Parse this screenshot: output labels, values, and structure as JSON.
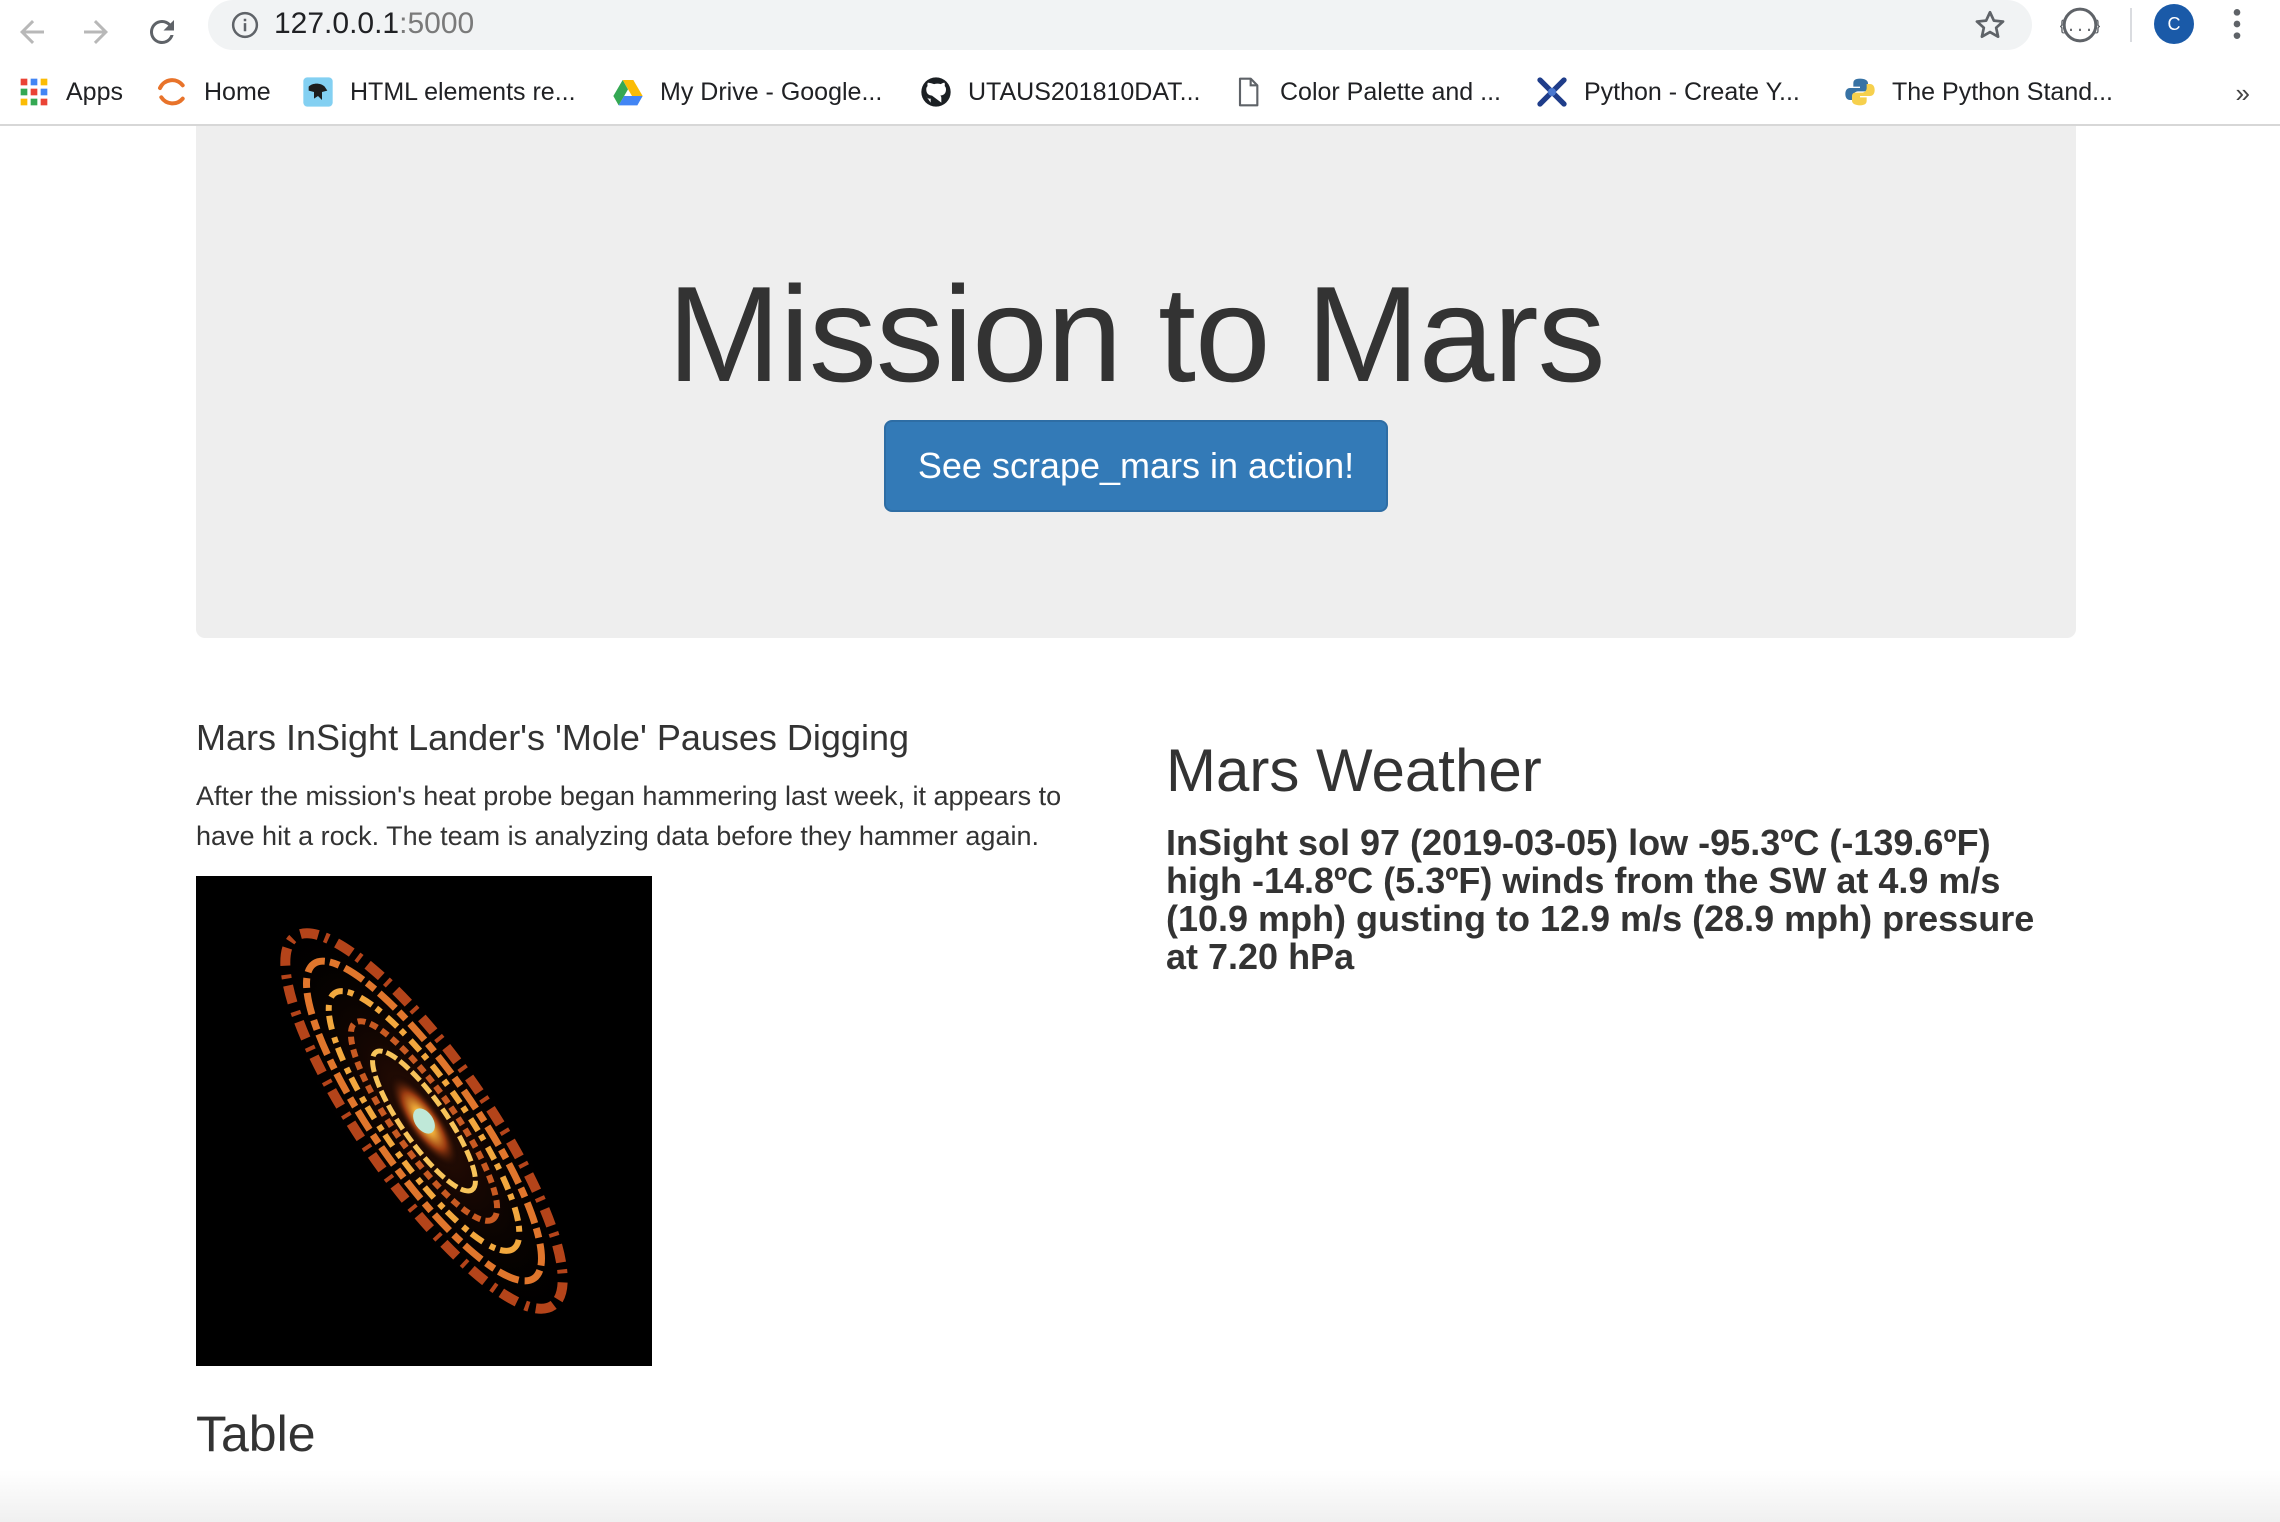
{
  "browser": {
    "url_host": "127.0.0.1",
    "url_port": ":5000",
    "profile_initial": "C",
    "bookmarks": [
      {
        "label": "Apps",
        "icon": "apps-grid-icon"
      },
      {
        "label": "Home",
        "icon": "home-swirl-icon"
      },
      {
        "label": "HTML elements re...",
        "icon": "mdn-dino-icon"
      },
      {
        "label": "My Drive - Google...",
        "icon": "google-drive-icon"
      },
      {
        "label": "UTAUS201810DAT...",
        "icon": "github-icon"
      },
      {
        "label": "Color Palette and ...",
        "icon": "document-icon"
      },
      {
        "label": "Python - Create Y...",
        "icon": "python-x-icon"
      },
      {
        "label": "The Python Stand...",
        "icon": "python-logo-icon"
      }
    ],
    "bookmarks_more": "»"
  },
  "page": {
    "title": "Mission to Mars",
    "action_button": "See scrape_mars in action!",
    "news_title": "Mars InSight Lander's 'Mole' Pauses Digging",
    "news_paragraph": "After the mission's heat probe began hammering last week, it appears to have hit a rock. The team is analyzing data before they hammer again.",
    "weather_heading": "Mars Weather",
    "weather_text": "InSight sol 97 (2019-03-05) low -95.3ºC (-139.6ºF) high -14.8ºC (5.3ºF) winds from the SW at 4.9 m/s (10.9 mph) gusting to 12.9 m/s (28.9 mph) pressure at 7.20 hPa",
    "table_heading": "Table"
  },
  "colors": {
    "jumbotron_bg": "#eeeeee",
    "button_primary": "#337ab7",
    "text": "#333333"
  }
}
